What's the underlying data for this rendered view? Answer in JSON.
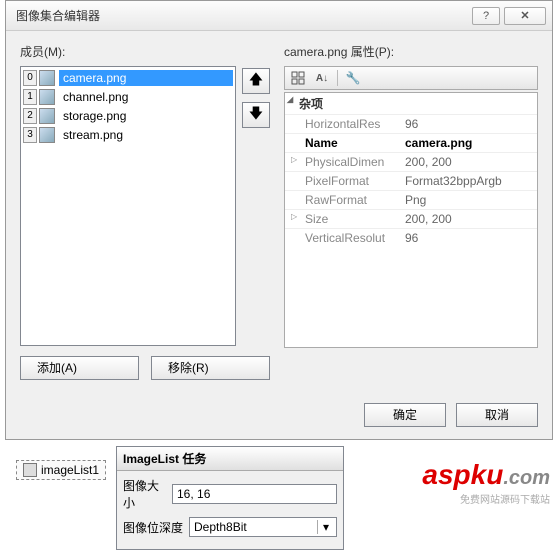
{
  "dialog": {
    "title": "图像集合编辑器",
    "help_glyph": "?",
    "close_glyph": "✕",
    "members_label": "成员(M):",
    "props_label": "camera.png 属性(P):",
    "members": [
      {
        "idx": "0",
        "name": "camera.png",
        "selected": true
      },
      {
        "idx": "1",
        "name": "channel.png",
        "selected": false
      },
      {
        "idx": "2",
        "name": "storage.png",
        "selected": false
      },
      {
        "idx": "3",
        "name": "stream.png",
        "selected": false
      }
    ],
    "up_glyph": "🡅",
    "down_glyph": "🡇",
    "add_btn": "添加(A)",
    "remove_btn": "移除(R)",
    "ok_btn": "确定",
    "cancel_btn": "取消"
  },
  "toolbar": {
    "cat_tip": "分类",
    "az_tip": "A-Z",
    "prop_tip": "属性"
  },
  "props": {
    "category": "杂项",
    "rows": [
      {
        "key": "HorizontalResolution",
        "key_short": "HorizontalRes",
        "val": "96",
        "expandable": false,
        "bold": false
      },
      {
        "key": "Name",
        "key_short": "Name",
        "val": "camera.png",
        "expandable": false,
        "bold": true
      },
      {
        "key": "PhysicalDimension",
        "key_short": "PhysicalDimen",
        "val": "200, 200",
        "expandable": true,
        "bold": false
      },
      {
        "key": "PixelFormat",
        "key_short": "PixelFormat",
        "val": "Format32bppArgb",
        "expandable": false,
        "bold": false
      },
      {
        "key": "RawFormat",
        "key_short": "RawFormat",
        "val": "Png",
        "expandable": false,
        "bold": false
      },
      {
        "key": "Size",
        "key_short": "Size",
        "val": "200, 200",
        "expandable": true,
        "bold": false
      },
      {
        "key": "VerticalResolution",
        "key_short": "VerticalResolut",
        "val": "96",
        "expandable": false,
        "bold": false
      }
    ]
  },
  "tag": {
    "component": "imageList1",
    "header": "ImageList 任务",
    "size_label": "图像大小",
    "size_value": "16, 16",
    "depth_label": "图像位深度",
    "depth_value": "Depth8Bit"
  },
  "watermark": {
    "brand_a": "aspku",
    "brand_b": ".com",
    "sub": "免费网站源码下载站"
  }
}
